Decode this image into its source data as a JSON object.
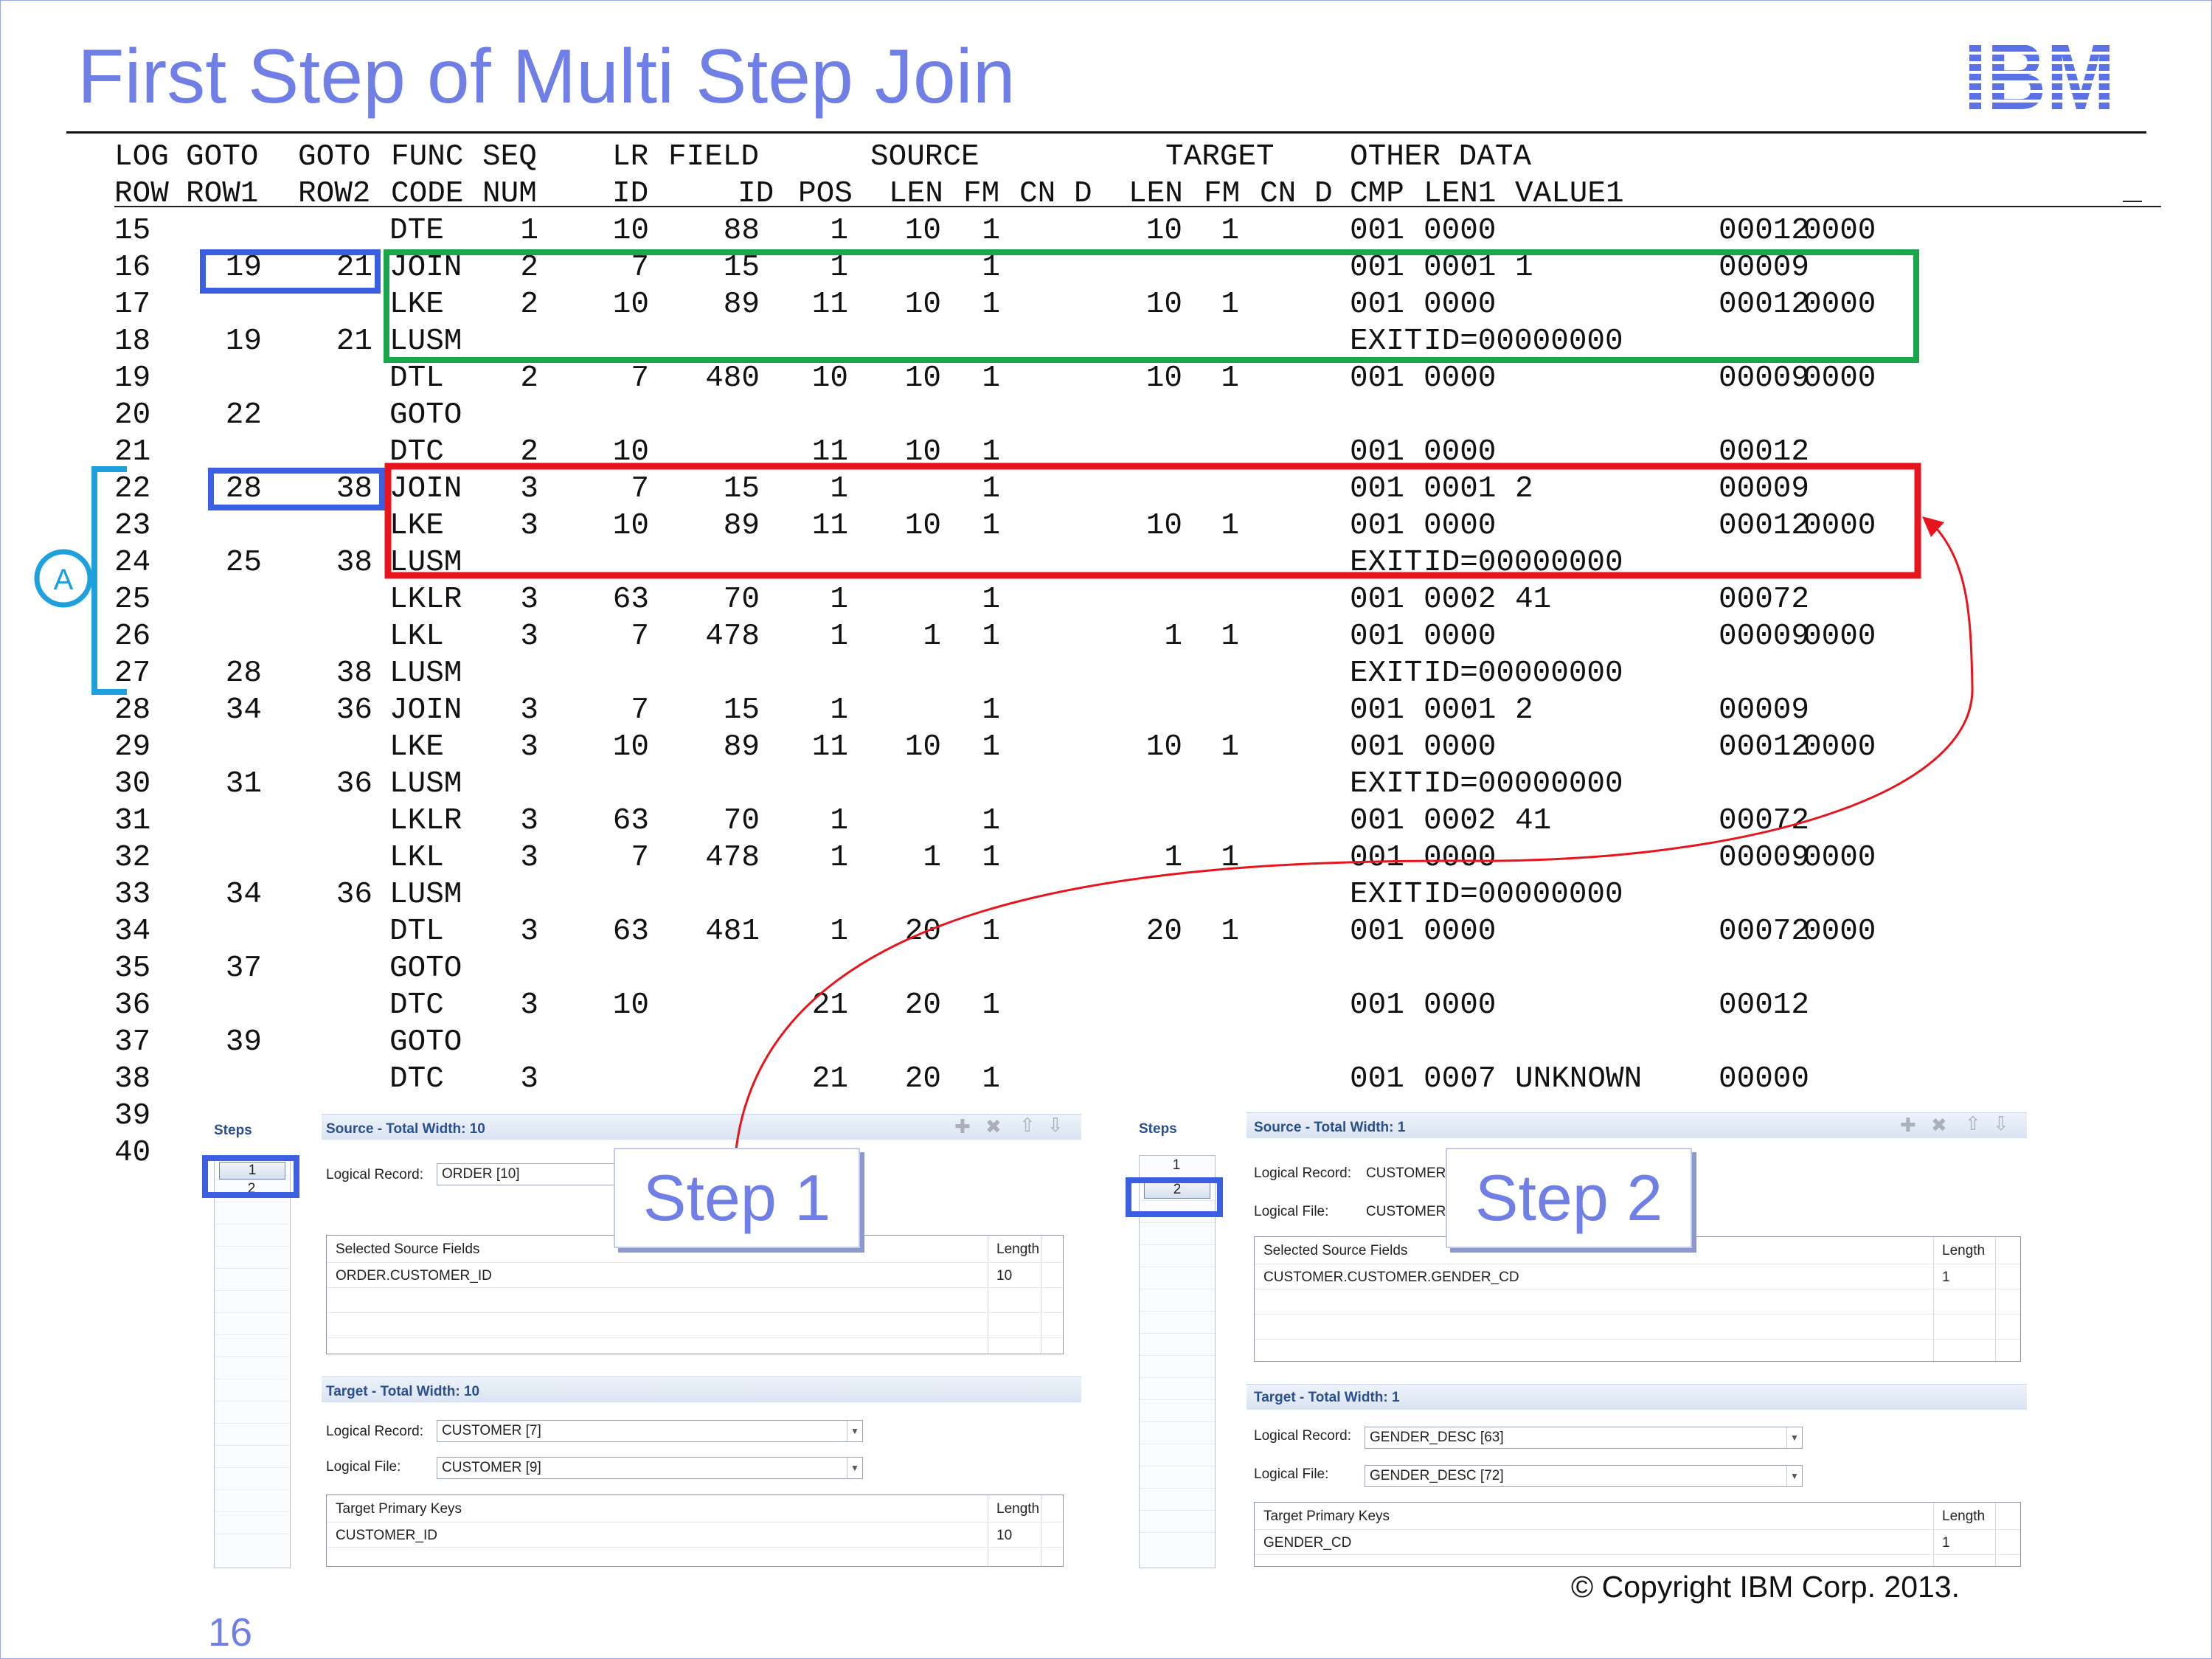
{
  "title": "First Step of Multi Step Join",
  "brand_color": "#6f7fe6",
  "logo": {
    "text": "IBM",
    "color": "#5b72e6"
  },
  "header_rows": [
    [
      "LOG",
      "GOTO",
      "GOTO",
      "FUNC",
      "SEQ",
      "LR",
      "FIELD",
      "SOURCE",
      "TARGET",
      "OTHER DATA"
    ],
    [
      "ROW",
      "ROW1",
      "ROW2",
      "CODE",
      "NUM",
      "ID",
      "ID",
      "POS",
      "LEN",
      "FM",
      "CN",
      "D",
      "LEN",
      "FM",
      "CN",
      "D",
      "CMP",
      "LEN1",
      "VALUE1"
    ]
  ],
  "logic_table": [
    [
      "15",
      "",
      "",
      "DTE",
      "1",
      "10",
      "88",
      "1",
      "10",
      "1",
      "10",
      "1",
      "001",
      "0000",
      "",
      "00012",
      "0000"
    ],
    [
      "16",
      "19",
      "21",
      "JOIN",
      "2",
      "7",
      "15",
      "1",
      "",
      "1",
      "",
      "",
      "001",
      "0001",
      "1",
      "00009",
      ""
    ],
    [
      "17",
      "",
      "",
      "LKE",
      "2",
      "10",
      "89",
      "11",
      "10",
      "1",
      "10",
      "1",
      "001",
      "0000",
      "",
      "00012",
      "0000"
    ],
    [
      "18",
      "19",
      "21",
      "LUSM",
      "",
      "",
      "",
      "",
      "",
      "",
      "",
      "",
      "EXIT",
      "ID=00000000",
      "",
      "",
      ""
    ],
    [
      "19",
      "",
      "",
      "DTL",
      "2",
      "7",
      "480",
      "10",
      "10",
      "1",
      "10",
      "1",
      "001",
      "0000",
      "",
      "00009",
      "0000"
    ],
    [
      "20",
      "22",
      "",
      "GOTO",
      "",
      "",
      "",
      "",
      "",
      "",
      "",
      "",
      "",
      "",
      "",
      "",
      ""
    ],
    [
      "21",
      "",
      "",
      "DTC",
      "2",
      "10",
      "",
      "11",
      "10",
      "1",
      "",
      "",
      "001",
      "0000",
      "",
      "00012",
      ""
    ],
    [
      "22",
      "28",
      "38",
      "JOIN",
      "3",
      "7",
      "15",
      "1",
      "",
      "1",
      "",
      "",
      "001",
      "0001",
      "2",
      "00009",
      ""
    ],
    [
      "23",
      "",
      "",
      "LKE",
      "3",
      "10",
      "89",
      "11",
      "10",
      "1",
      "10",
      "1",
      "001",
      "0000",
      "",
      "00012",
      "0000"
    ],
    [
      "24",
      "25",
      "38",
      "LUSM",
      "",
      "",
      "",
      "",
      "",
      "",
      "",
      "",
      "EXIT",
      "ID=00000000",
      "",
      "",
      ""
    ],
    [
      "25",
      "",
      "",
      "LKLR",
      "3",
      "63",
      "70",
      "1",
      "",
      "1",
      "",
      "",
      "001",
      "0002",
      "41",
      "00072",
      ""
    ],
    [
      "26",
      "",
      "",
      "LKL",
      "3",
      "7",
      "478",
      "1",
      "1",
      "1",
      "1",
      "1",
      "001",
      "0000",
      "",
      "00009",
      "0000"
    ],
    [
      "27",
      "28",
      "38",
      "LUSM",
      "",
      "",
      "",
      "",
      "",
      "",
      "",
      "",
      "EXIT",
      "ID=00000000",
      "",
      "",
      ""
    ],
    [
      "28",
      "34",
      "36",
      "JOIN",
      "3",
      "7",
      "15",
      "1",
      "",
      "1",
      "",
      "",
      "001",
      "0001",
      "2",
      "00009",
      ""
    ],
    [
      "29",
      "",
      "",
      "LKE",
      "3",
      "10",
      "89",
      "11",
      "10",
      "1",
      "10",
      "1",
      "001",
      "0000",
      "",
      "00012",
      "0000"
    ],
    [
      "30",
      "31",
      "36",
      "LUSM",
      "",
      "",
      "",
      "",
      "",
      "",
      "",
      "",
      "EXIT",
      "ID=00000000",
      "",
      "",
      ""
    ],
    [
      "31",
      "",
      "",
      "LKLR",
      "3",
      "63",
      "70",
      "1",
      "",
      "1",
      "",
      "",
      "001",
      "0002",
      "41",
      "00072",
      ""
    ],
    [
      "32",
      "",
      "",
      "LKL",
      "3",
      "7",
      "478",
      "1",
      "1",
      "1",
      "1",
      "1",
      "001",
      "0000",
      "",
      "00009",
      "0000"
    ],
    [
      "33",
      "34",
      "36",
      "LUSM",
      "",
      "",
      "",
      "",
      "",
      "",
      "",
      "",
      "EXIT",
      "ID=00000000",
      "",
      "",
      ""
    ],
    [
      "34",
      "",
      "",
      "DTL",
      "3",
      "63",
      "481",
      "1",
      "20",
      "1",
      "20",
      "1",
      "001",
      "0000",
      "",
      "00072",
      "0000"
    ],
    [
      "35",
      "37",
      "",
      "GOTO",
      "",
      "",
      "",
      "",
      "",
      "",
      "",
      "",
      "",
      "",
      "",
      "",
      ""
    ],
    [
      "36",
      "",
      "",
      "DTC",
      "3",
      "10",
      "",
      "21",
      "20",
      "1",
      "",
      "",
      "001",
      "0000",
      "",
      "00012",
      ""
    ],
    [
      "37",
      "39",
      "",
      "GOTO",
      "",
      "",
      "",
      "",
      "",
      "",
      "",
      "",
      "",
      "",
      "",
      "",
      ""
    ],
    [
      "38",
      "",
      "",
      "DTC",
      "3",
      "",
      "",
      "21",
      "20",
      "1",
      "",
      "",
      "001",
      "0007",
      "UNKNOWN",
      "00000",
      ""
    ],
    [
      "39",
      "",
      "",
      "",
      "",
      "",
      "",
      "",
      "",
      "",
      "",
      "",
      "",
      "",
      "",
      "",
      ""
    ],
    [
      "40",
      "",
      "",
      "",
      "",
      "",
      "",
      "",
      "",
      "",
      "",
      "",
      "",
      "",
      "",
      "",
      ""
    ]
  ],
  "annotation": {
    "bracket_label": "A",
    "bracket_color": "#1ea0dc",
    "goto_box_color": "#3b5fe0",
    "step1_box_color": "#1aa64a",
    "step2_box_color": "#e8141b"
  },
  "panel_step1": {
    "steps_label": "Steps",
    "steps": [
      "1",
      "2"
    ],
    "selected_step": "1",
    "source_title": "Source - Total Width: 10",
    "logical_record_label": "Logical Record:",
    "logical_record_value": "ORDER [10]",
    "source_table_header": "Selected Source Fields",
    "length_header": "Length",
    "source_rows": [
      {
        "field": "ORDER.CUSTOMER_ID",
        "length": "10"
      }
    ],
    "target_title": "Target - Total Width: 10",
    "target_lr_label": "Logical Record:",
    "target_lr_value": "CUSTOMER [7]",
    "target_lf_label": "Logical File:",
    "target_lf_value": "CUSTOMER [9]",
    "target_table_header": "Target Primary Keys",
    "target_length_header": "Length",
    "target_rows": [
      {
        "field": "CUSTOMER_ID",
        "length": "10"
      }
    ]
  },
  "panel_step2": {
    "steps_label": "Steps",
    "steps": [
      "1",
      "2"
    ],
    "selected_step": "2",
    "source_title": "Source - Total Width: 1",
    "logical_record_label": "Logical Record:",
    "logical_record_value": "CUSTOMER",
    "logical_file_label": "Logical File:",
    "logical_file_value": "CUSTOMER",
    "source_table_header": "Selected Source Fields",
    "length_header": "Length",
    "source_rows": [
      {
        "field": "CUSTOMER.CUSTOMER.GENDER_CD",
        "length": "1"
      }
    ],
    "target_title": "Target - Total Width: 1",
    "target_lr_label": "Logical Record:",
    "target_lr_value": "GENDER_DESC [63]",
    "target_lf_label": "Logical File:",
    "target_lf_value": "GENDER_DESC [72]",
    "target_table_header": "Target Primary Keys",
    "target_length_header": "Length",
    "target_rows": [
      {
        "field": "GENDER_CD",
        "length": "1"
      }
    ]
  },
  "callouts": {
    "step1": "Step 1",
    "step2": "Step 2"
  },
  "copyright": "© Copyright IBM Corp. 2013.",
  "page_number": "16"
}
